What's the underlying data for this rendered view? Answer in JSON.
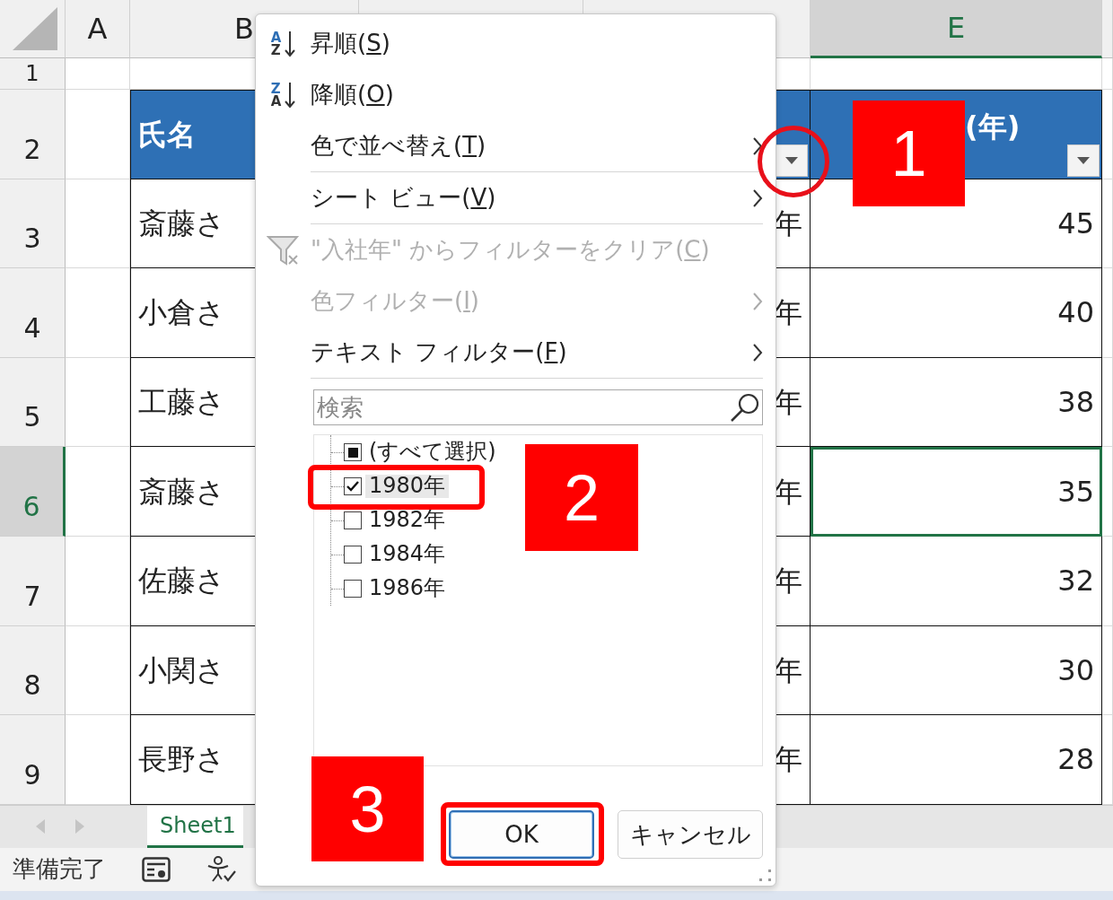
{
  "column_headers": [
    {
      "label": "A",
      "selected": false
    },
    {
      "label": "B",
      "selected": false
    },
    {
      "label": "E",
      "selected": true
    }
  ],
  "row_headers": [
    {
      "label": "1",
      "selected": false
    },
    {
      "label": "2",
      "selected": false
    },
    {
      "label": "3",
      "selected": false
    },
    {
      "label": "4",
      "selected": false
    },
    {
      "label": "5",
      "selected": false
    },
    {
      "label": "6",
      "selected": true
    },
    {
      "label": "7",
      "selected": false
    },
    {
      "label": "8",
      "selected": false
    },
    {
      "label": "9",
      "selected": false
    }
  ],
  "header_row": {
    "name": "氏名",
    "column_e": "(年)"
  },
  "rows": [
    {
      "name": "斎藤さ",
      "column_d": "年",
      "column_e": "45",
      "selected": false
    },
    {
      "name": "小倉さ",
      "column_d": "年",
      "column_e": "40",
      "selected": false
    },
    {
      "name": "工藤さ",
      "column_d": "年",
      "column_e": "38",
      "selected": false
    },
    {
      "name": "斎藤さ",
      "column_d": "年",
      "column_e": "35",
      "selected": true
    },
    {
      "name": "佐藤さ",
      "column_d": "年",
      "column_e": "32",
      "selected": false
    },
    {
      "name": "小関さ",
      "column_d": "年",
      "column_e": "30",
      "selected": false
    },
    {
      "name": "長野さ",
      "column_d": "年",
      "column_e": "28",
      "selected": false
    }
  ],
  "filter_menu": {
    "items": [
      {
        "kind": "sort-ascending",
        "icon_letters": [
          "A",
          "Z"
        ],
        "before": "昇順(",
        "key": "S",
        "after": ")",
        "disabled": false,
        "submenu": false
      },
      {
        "kind": "sort-descending",
        "icon_letters": [
          "Z",
          "A"
        ],
        "before": "降順(",
        "key": "O",
        "after": ")",
        "disabled": false,
        "submenu": false
      },
      {
        "kind": "plain",
        "before": "色で並べ替え(",
        "key": "T",
        "after": ")",
        "disabled": false,
        "submenu": true
      },
      {
        "kind": "divider"
      },
      {
        "kind": "plain",
        "before": "シート ビュー(",
        "key": "V",
        "after": ")",
        "disabled": false,
        "submenu": true
      },
      {
        "kind": "divider"
      },
      {
        "kind": "clear-filter",
        "before": "\"入社年\" からフィルターをクリア(",
        "key": "C",
        "after": ")",
        "disabled": true,
        "submenu": false
      },
      {
        "kind": "plain",
        "before": "色フィルター(",
        "key": "I",
        "after": ")",
        "disabled": true,
        "submenu": true
      },
      {
        "kind": "plain",
        "before": "テキスト フィルター(",
        "key": "F",
        "after": ")",
        "disabled": false,
        "submenu": true
      },
      {
        "kind": "divider"
      }
    ],
    "search": {
      "placeholder": "検索"
    },
    "values": [
      {
        "label": "(すべて選択)",
        "checked": false,
        "indeterminate": true,
        "focused": false
      },
      {
        "label": "1980年",
        "checked": true,
        "focused": true
      },
      {
        "label": "1982年",
        "checked": false,
        "focused": false
      },
      {
        "label": "1984年",
        "checked": false,
        "focused": false
      },
      {
        "label": "1986年",
        "checked": false,
        "focused": false
      }
    ],
    "buttons": [
      {
        "label": "OK",
        "focused": true
      },
      {
        "label": "キャンセル",
        "focused": false
      }
    ]
  },
  "sheet_tabs": [
    {
      "label": "Sheet1",
      "selected": true
    }
  ],
  "status_bar": {
    "text": "準備完了"
  },
  "annotations": [
    {
      "kind": "circle"
    },
    {
      "kind": "number",
      "text": "1"
    },
    {
      "kind": "number",
      "text": "2"
    },
    {
      "kind": "outline"
    },
    {
      "kind": "number",
      "text": "3"
    },
    {
      "kind": "outline"
    }
  ]
}
